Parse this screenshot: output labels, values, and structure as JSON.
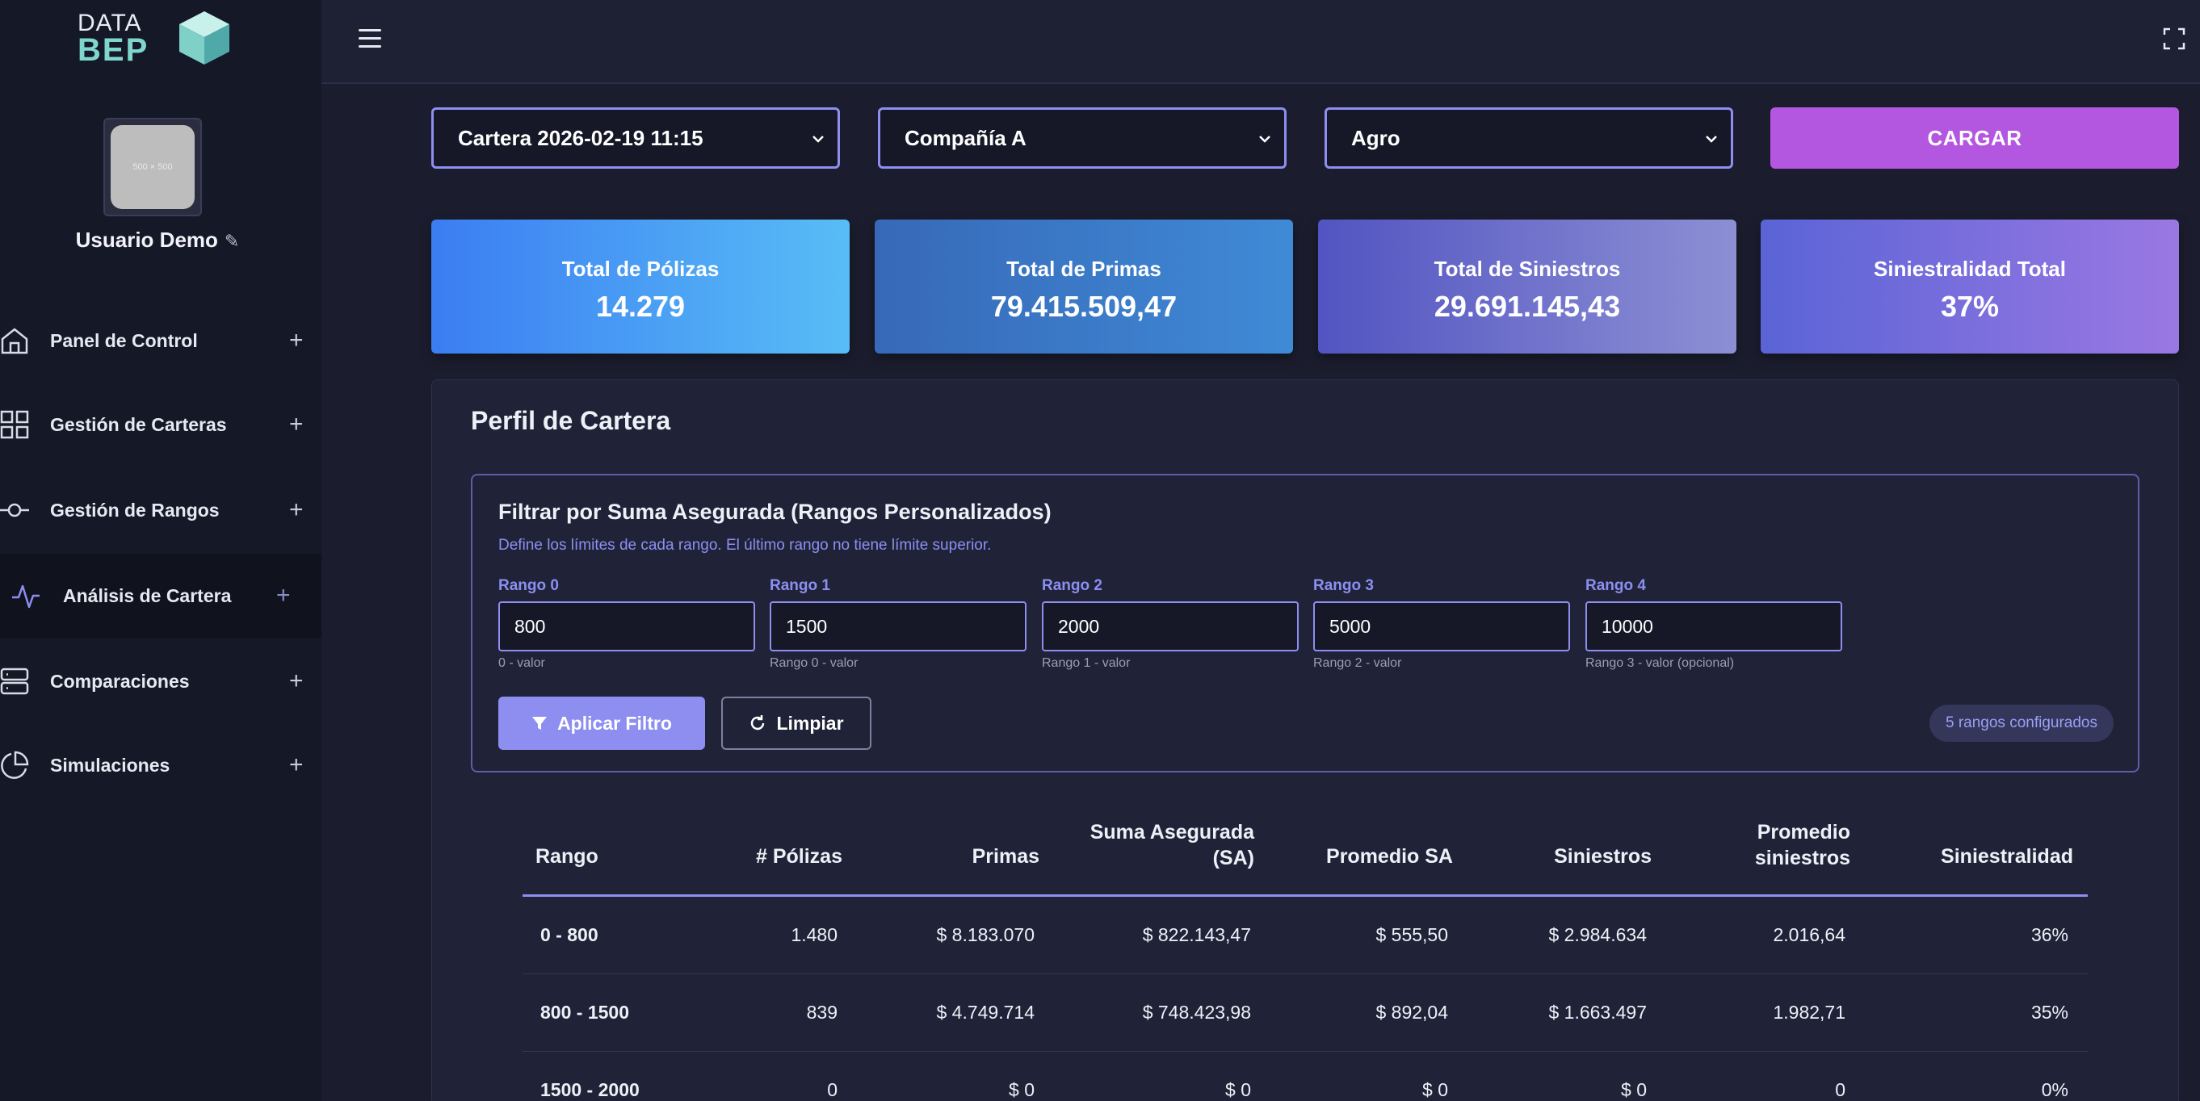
{
  "brand": {
    "logo_line1": "DATA",
    "logo_line2": "BEP"
  },
  "user": {
    "avatar_placeholder": "500 × 500",
    "name": "Usuario Demo"
  },
  "sidebar": {
    "items": [
      {
        "label": "Panel de Control",
        "icon": "home-icon",
        "active": false
      },
      {
        "label": "Gestión de Carteras",
        "icon": "grid-icon",
        "active": false
      },
      {
        "label": "Gestión de Rangos",
        "icon": "range-icon",
        "active": false
      },
      {
        "label": "Análisis de Cartera",
        "icon": "activity-icon",
        "active": true
      },
      {
        "label": "Comparaciones",
        "icon": "server-icon",
        "active": false
      },
      {
        "label": "Simulaciones",
        "icon": "pie-icon",
        "active": false
      }
    ]
  },
  "filters": {
    "portfolio": "Cartera 2026-02-19 11:15",
    "company": "Compañía A",
    "line": "Agro",
    "load_label": "CARGAR"
  },
  "stats": [
    {
      "label": "Total de Pólizas",
      "value": "14.279"
    },
    {
      "label": "Total de Primas",
      "value": "79.415.509,47"
    },
    {
      "label": "Total de Siniestros",
      "value": "29.691.145,43"
    },
    {
      "label": "Siniestralidad Total",
      "value": "37%"
    }
  ],
  "panel": {
    "title": "Perfil de Cartera",
    "filter_title": "Filtrar por Suma Asegurada (Rangos Personalizados)",
    "filter_desc": "Define los límites de cada rango. El último rango no tiene límite superior.",
    "ranges": [
      {
        "label": "Rango 0",
        "value": "800",
        "hint": "0 - valor"
      },
      {
        "label": "Rango 1",
        "value": "1500",
        "hint": "Rango 0 - valor"
      },
      {
        "label": "Rango 2",
        "value": "2000",
        "hint": "Rango 1 - valor"
      },
      {
        "label": "Rango 3",
        "value": "5000",
        "hint": "Rango 2 - valor"
      },
      {
        "label": "Rango 4",
        "value": "10000",
        "hint": "Rango 3 - valor (opcional)"
      }
    ],
    "apply_label": "Aplicar Filtro",
    "clear_label": "Limpiar",
    "badge": "5 rangos configurados"
  },
  "table": {
    "headers": [
      "Rango",
      "# Pólizas",
      "Primas",
      "Suma Asegurada (SA)",
      "Promedio SA",
      "Siniestros",
      "Promedio siniestros",
      "Siniestralidad"
    ],
    "header_lines": [
      [
        "Rango"
      ],
      [
        "# Pólizas"
      ],
      [
        "Primas"
      ],
      [
        "Suma Asegurada",
        "(SA)"
      ],
      [
        "Promedio SA"
      ],
      [
        "Siniestros"
      ],
      [
        "Promedio",
        "siniestros"
      ],
      [
        "Siniestralidad"
      ]
    ],
    "rows": [
      [
        "0 - 800",
        "1.480",
        "$ 8.183.070",
        "$ 822.143,47",
        "$ 555,50",
        "$ 2.984.634",
        "2.016,64",
        "36%"
      ],
      [
        "800 - 1500",
        "839",
        "$ 4.749.714",
        "$ 748.423,98",
        "$ 892,04",
        "$ 1.663.497",
        "1.982,71",
        "35%"
      ],
      [
        "1500 - 2000",
        "0",
        "$ 0",
        "$ 0",
        "$ 0",
        "$ 0",
        "0",
        "0%"
      ]
    ]
  },
  "colors": {
    "accent": "#8d8ef0",
    "load_button": "#b457e0",
    "card1": [
      "#3b7df2",
      "#58bdf6"
    ],
    "card2": [
      "#3769b8",
      "#3f8ad6"
    ],
    "card3": [
      "#5254c2",
      "#8d8fd4"
    ],
    "card4": [
      "#5a64d6",
      "#9a78e3"
    ]
  }
}
